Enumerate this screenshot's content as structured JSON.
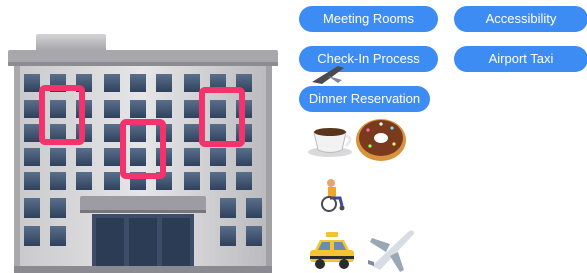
{
  "chips": {
    "meeting_rooms": "Meeting Rooms",
    "accessibility": "Accessibility",
    "check_in": "Check-In Process",
    "airport_taxi": "Airport Taxi",
    "dinner": "Dinner Reservation"
  },
  "icons": {
    "building": "office-building-emoji",
    "coffee": "hot-beverage-emoji",
    "donut": "doughnut-emoji",
    "wheelchair": "person-in-wheelchair-emoji",
    "taxi": "taxi-emoji",
    "plane": "airplane-emoji"
  },
  "colors": {
    "chip": "#3d8cf4",
    "chip_text": "#ffffff",
    "highlight": "#f4336c"
  }
}
